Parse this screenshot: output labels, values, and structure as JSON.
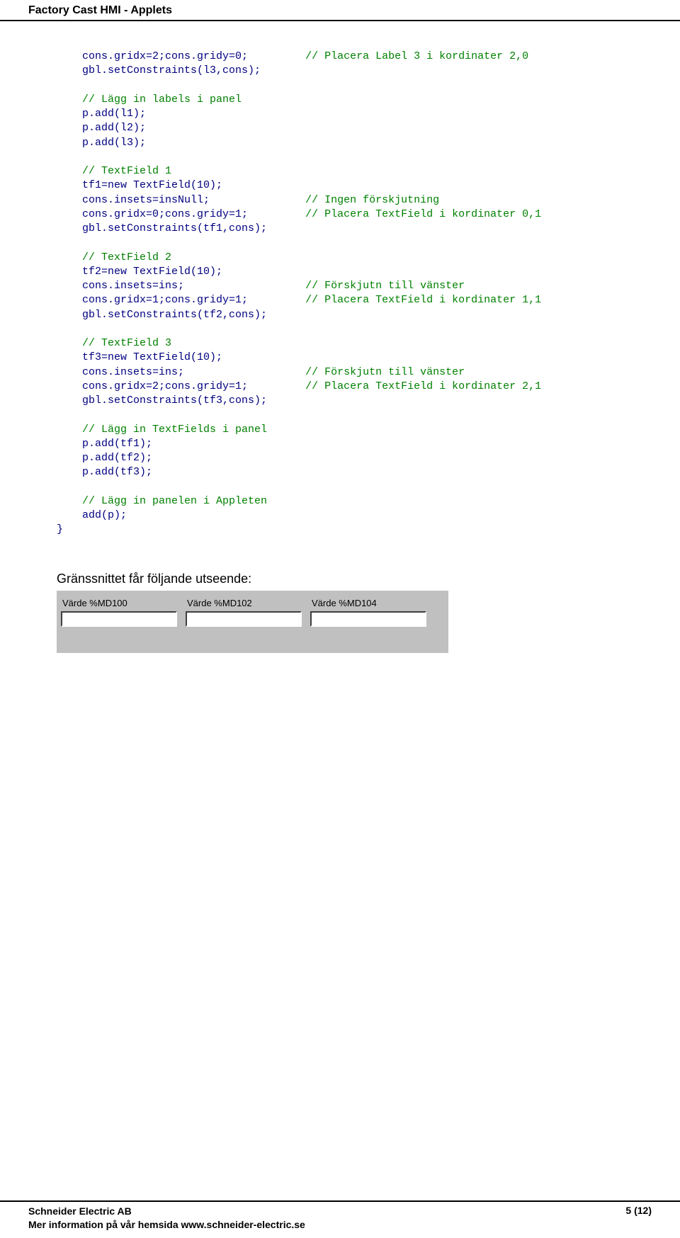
{
  "header": "Factory Cast HMI - Applets",
  "code": {
    "l1": "cons.gridx=2;cons.gridy=0;",
    "c1": "// Placera Label 3 i kordinater 2,0",
    "l2": "gbl.setConstraints(l3,cons);",
    "c2": "// Lägg in labels i panel",
    "l3": "p.add(l1);",
    "l4": "p.add(l2);",
    "l5": "p.add(l3);",
    "c3": "// TextField 1",
    "l6": "tf1=new TextField(10);",
    "l7": "cons.insets=insNull;",
    "c4": "// Ingen förskjutning",
    "l8": "cons.gridx=0;cons.gridy=1;",
    "c5": "// Placera TextField i kordinater 0,1",
    "l9": "gbl.setConstraints(tf1,cons);",
    "c6": "// TextField 2",
    "l10": "tf2=new TextField(10);",
    "l11": "cons.insets=ins;",
    "c7": "// Förskjutn till vänster",
    "l12": "cons.gridx=1;cons.gridy=1;",
    "c8": "// Placera TextField i kordinater 1,1",
    "l13": "gbl.setConstraints(tf2,cons);",
    "c9": "// TextField 3",
    "l14": "tf3=new TextField(10);",
    "l15": "cons.insets=ins;",
    "c10": "// Förskjutn till vänster",
    "l16": "cons.gridx=2;cons.gridy=1;",
    "c11": "// Placera TextField i kordinater 2,1",
    "l17": "gbl.setConstraints(tf3,cons);",
    "c12": "// Lägg in TextFields i panel",
    "l18": "p.add(tf1);",
    "l19": "p.add(tf2);",
    "l20": "p.add(tf3);",
    "c13": "// Lägg in panelen i Appleten",
    "l21": "add(p);",
    "brace": "}"
  },
  "section_title": "Gränssnittet får följande utseende:",
  "fields": [
    {
      "label": "Värde %MD100",
      "value": ""
    },
    {
      "label": "Värde %MD102",
      "value": ""
    },
    {
      "label": "Värde %MD104",
      "value": ""
    }
  ],
  "footer": {
    "company": "Schneider Electric AB",
    "info": "Mer information på vår hemsida www.schneider-electric.se",
    "page": "5 (12)"
  }
}
